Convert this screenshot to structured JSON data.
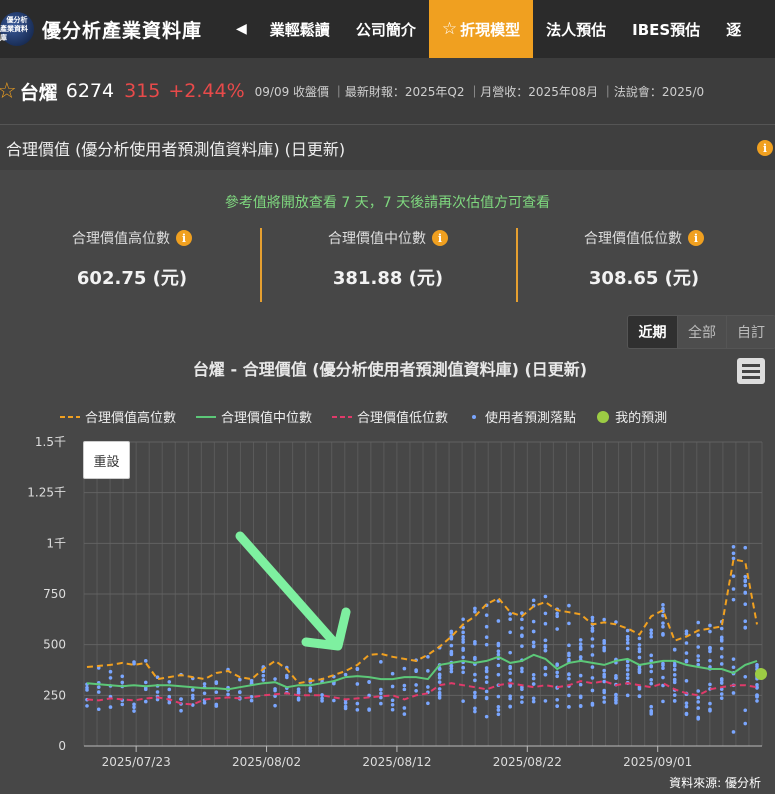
{
  "nav": {
    "logo_line1": "優分析",
    "logo_line2": "產業資料庫",
    "brand": "優分析產業資料庫",
    "prev": "◀",
    "tabs": [
      {
        "label": "業輕鬆讀",
        "active": false
      },
      {
        "label": "公司簡介",
        "active": false
      },
      {
        "label": "折現模型",
        "active": true
      },
      {
        "label": "法人預估",
        "active": false
      },
      {
        "label": "IBES預估",
        "active": false
      },
      {
        "label": "逐",
        "active": false
      }
    ]
  },
  "stock": {
    "name": "台燿",
    "code": "6274",
    "price": "315",
    "change": "+2.44%",
    "meta": "09/09 收盤價 ｜最新財報：2025年Q2 ｜月營收：2025年08月 ｜法說會：2025/0"
  },
  "section": {
    "title": "合理價值 (優分析使用者預測值資料庫) (日更新)",
    "notice": "參考值將開放查看 7 天，7 天後請再次估值方可查看"
  },
  "stats": [
    {
      "label": "合理價值高位數",
      "value": "602.75 (元)"
    },
    {
      "label": "合理價值中位數",
      "value": "381.88 (元)"
    },
    {
      "label": "合理價值低位數",
      "value": "308.65 (元)"
    }
  ],
  "range": {
    "recent": "近期",
    "all": "全部",
    "custom": "自訂"
  },
  "reset_label": "重設",
  "source": "資料來源: 優分析",
  "colors": {
    "high": "#f0a020",
    "mid": "#5cc878",
    "low": "#e03a6a",
    "dots": "#7aa6ff",
    "mine": "#9ccc44",
    "accent": "#f0a020"
  },
  "chart_data": {
    "type": "line",
    "title": "台燿 - 合理價值 (優分析使用者預測值資料庫) (日更新)",
    "ylim": [
      0,
      1500
    ],
    "yticks": [
      0,
      250,
      500,
      750,
      1000,
      1250,
      1500
    ],
    "ytick_labels": [
      "0",
      "250",
      "500",
      "750",
      "1千",
      "1.25千",
      "1.5千"
    ],
    "xtick_labels": [
      "2025/07/23",
      "2025/08/02",
      "2025/08/12",
      "2025/08/22",
      "2025/09/01"
    ],
    "x_start": "2025/07/19",
    "x_end": "2025/09/09",
    "grid": true,
    "legend_position": "top",
    "series": [
      {
        "name": "合理價值高位數",
        "style": "dashed",
        "color": "#f0a020",
        "values": [
          390,
          395,
          400,
          410,
          400,
          410,
          330,
          340,
          350,
          340,
          330,
          360,
          370,
          340,
          330,
          380,
          420,
          380,
          310,
          320,
          330,
          350,
          370,
          400,
          450,
          455,
          440,
          430,
          420,
          450,
          490,
          540,
          600,
          640,
          700,
          730,
          660,
          640,
          690,
          710,
          670,
          660,
          650,
          600,
          610,
          600,
          580,
          550,
          640,
          670,
          520,
          540,
          570,
          580,
          590,
          920,
          910,
          600
        ]
      },
      {
        "name": "合理價值中位數",
        "style": "solid",
        "color": "#5cc878",
        "values": [
          310,
          305,
          300,
          295,
          300,
          295,
          300,
          300,
          295,
          290,
          285,
          285,
          280,
          290,
          300,
          310,
          315,
          290,
          300,
          300,
          310,
          320,
          340,
          345,
          340,
          330,
          330,
          340,
          340,
          330,
          400,
          410,
          420,
          410,
          420,
          440,
          410,
          420,
          450,
          430,
          380,
          410,
          420,
          410,
          400,
          420,
          430,
          400,
          410,
          420,
          420,
          400,
          390,
          380,
          380,
          360,
          400,
          420
        ]
      },
      {
        "name": "合理價值低位數",
        "style": "dashed",
        "color": "#e03a6a",
        "values": [
          230,
          225,
          235,
          230,
          225,
          235,
          240,
          230,
          210,
          205,
          230,
          235,
          240,
          235,
          240,
          250,
          255,
          260,
          250,
          250,
          250,
          240,
          230,
          235,
          240,
          245,
          250,
          230,
          250,
          260,
          300,
          310,
          300,
          290,
          280,
          300,
          310,
          300,
          290,
          300,
          290,
          300,
          320,
          310,
          320,
          300,
          310,
          300,
          290,
          310,
          280,
          260,
          250,
          280,
          290,
          300,
          300,
          290
        ]
      },
      {
        "name": "使用者預測落點",
        "style": "scatter",
        "color": "#7aa6ff"
      },
      {
        "name": "我的預測",
        "style": "marker",
        "color": "#9ccc44",
        "values": [
          355
        ]
      }
    ]
  }
}
